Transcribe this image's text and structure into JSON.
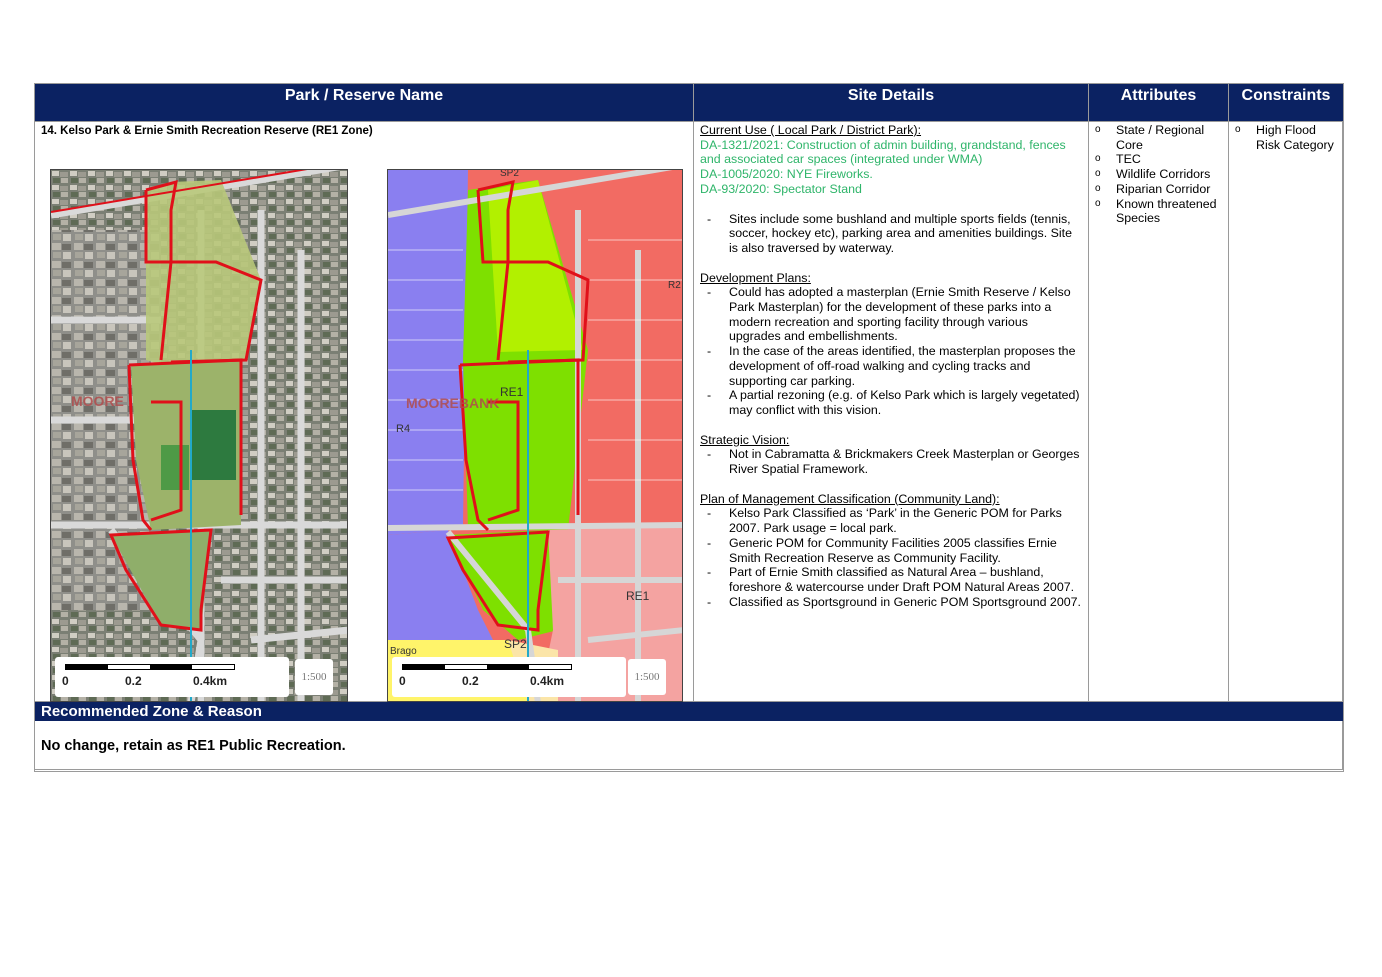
{
  "headers": {
    "park_name": "Park / Reserve Name",
    "site_details": "Site Details",
    "attributes": "Attributes",
    "constraints": "Constraints"
  },
  "reserve": {
    "title": "14. Kelso Park & Ernie Smith Recreation Reserve (RE1 Zone)"
  },
  "maps": {
    "aerial": {
      "label": "MOORE",
      "scale": [
        "0",
        "0.2",
        "0.4km"
      ],
      "zoom": "1:500"
    },
    "zoning": {
      "labels": [
        "MOOREBANK",
        "RE1",
        "RE1",
        "SP2",
        "R4",
        "SP2",
        "R2",
        "Brago"
      ],
      "scale": [
        "0",
        "0.2",
        "0.4km"
      ],
      "zoom": "1:500"
    }
  },
  "site": {
    "current_use_heading": "Current Use ( Local Park / District Park):",
    "da_lines": [
      "DA-1321/2021: Construction of admin building, grandstand, fences and associated car spaces (integrated under WMA)",
      "DA-1005/2020: NYE Fireworks.",
      "DA-93/2020: Spectator Stand"
    ],
    "current_use_items": [
      "Sites include some bushland and multiple sports fields (tennis, soccer, hockey etc), parking area and amenities buildings. Site is also traversed by waterway."
    ],
    "development_heading": "Development Plans:",
    "development_items": [
      "Could has adopted a masterplan (Ernie Smith Reserve / Kelso Park Masterplan) for the development of these parks into a modern recreation and sporting facility through various upgrades and embellishments.",
      "In the case of the areas identified, the masterplan proposes the development of off-road walking and cycling tracks and supporting car parking.",
      "A partial rezoning (e.g. of Kelso Park which is largely vegetated) may conflict with this vision."
    ],
    "strategic_heading": "Strategic Vision:",
    "strategic_items": [
      "Not in Cabramatta & Brickmakers Creek Masterplan or Georges River Spatial Framework."
    ],
    "pom_heading": "Plan of Management Classification (Community Land):",
    "pom_items": [
      "Kelso Park Classified as ‘Park’ in the Generic POM for Parks 2007. Park usage = local park.",
      "Generic POM for Community Facilities 2005 classifies Ernie Smith Recreation Reserve as Community Facility.",
      "Part of Ernie Smith classified as Natural Area – bushland, foreshore & watercourse under Draft POM Natural Areas 2007.",
      "Classified as Sportsground in Generic POM Sportsground 2007."
    ]
  },
  "attributes": [
    "State / Regional Core",
    "TEC",
    "Wildlife Corridors",
    "Riparian Corridor",
    "Known threatened Species"
  ],
  "constraints": [
    "High Flood Risk Category"
  ],
  "recommendation": {
    "heading": "Recommended Zone & Reason",
    "text": "No change, retain as RE1 Public Recreation."
  },
  "colors": {
    "header_bg": "#0b2262",
    "da_green": "#2fb56a",
    "zone_residential": "#f26b63",
    "zone_industrial": "#8a7ff0",
    "zone_recreation": "#7ee000",
    "boundary": "#e0101a"
  }
}
